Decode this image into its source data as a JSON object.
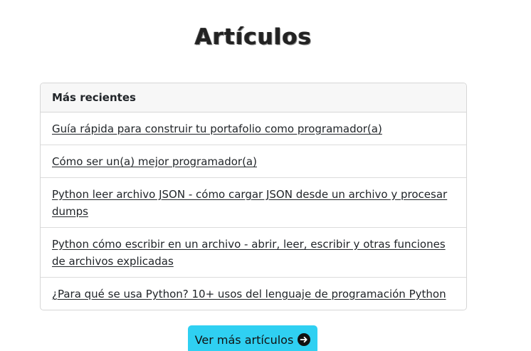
{
  "page": {
    "title": "Artículos"
  },
  "recent": {
    "header": "Más recientes",
    "items": [
      {
        "label": "Guía rápida para construir tu portafolio como programador(a)"
      },
      {
        "label": "Cómo ser un(a) mejor programador(a)"
      },
      {
        "label": "Python leer archivo JSON - cómo cargar JSON desde un archivo y procesar dumps"
      },
      {
        "label": "Python cómo escribir en un archivo - abrir, leer, escribir y otras funciones de archivos explicadas"
      },
      {
        "label": "¿Para qué se usa Python? 10+ usos del lenguaje de programación Python"
      }
    ]
  },
  "more_button": {
    "label": "Ver más artículos",
    "icon": "arrow-circle-right-icon",
    "color": "#2fd0f2"
  }
}
